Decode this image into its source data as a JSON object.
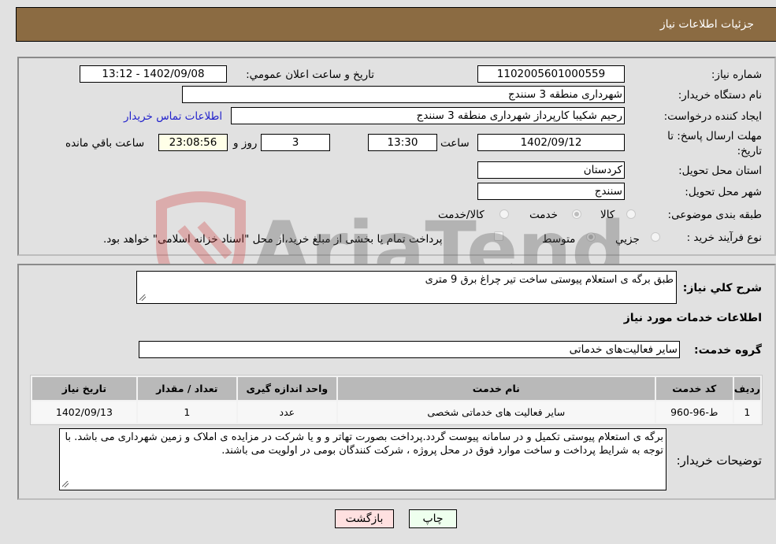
{
  "header": {
    "title": "جزئيات اطلاعات نياز"
  },
  "form": {
    "need_number": {
      "label": "شماره نياز:",
      "value": "1102005601000559"
    },
    "announce_datetime": {
      "label": "تاريخ و ساعت اعلان عمومي:",
      "value": "1402/09/08 - 13:12"
    },
    "buyer_org": {
      "label": "نام دستگاه خريدار:",
      "value": "شهرداری منطقه 3 سنندج"
    },
    "requester": {
      "label": "ايجاد کننده درخواست:",
      "value": "رحيم شکيبا کارپرداز شهرداری منطقه 3 سنندج"
    },
    "buyer_contact_link": "اطلاعات تماس خريدار",
    "deadline": {
      "label_line1": "مهلت ارسال پاسخ: تا",
      "label_line2": "تاريخ:",
      "date": "1402/09/12",
      "time_label": "ساعت",
      "time": "13:30",
      "days": "3",
      "days_label": "روز و",
      "remaining": "23:08:56",
      "remaining_label": "ساعت باقي مانده"
    },
    "province": {
      "label": "استان محل تحويل:",
      "value": "کردستان"
    },
    "city": {
      "label": "شهر محل تحويل:",
      "value": "سنندج"
    },
    "category": {
      "label": "طبقه بندی موضوعی:",
      "options": [
        "کالا",
        "خدمت",
        "کالا/خدمت"
      ],
      "selected": "خدمت"
    },
    "purchase_type": {
      "label": "نوع فرآيند خريد :",
      "options": [
        "جزيي",
        "متوسط"
      ],
      "selected": "متوسط",
      "treasury_note": "پرداخت تمام يا بخشی از مبلغ خريد،از محل \"اسناد خزانه اسلامی\" خواهد بود."
    }
  },
  "description": {
    "label": "شرح کلي نياز:",
    "value": "طبق برگه ی استعلام پيوستی ساخت تير چراغ برق 9 متری"
  },
  "services": {
    "section_title": "اطلاعات خدمات مورد نياز",
    "group_label": "گروه خدمت:",
    "group_value": "ساير فعاليت‌های خدماتی",
    "table": {
      "headers": [
        "رديف",
        "کد خدمت",
        "نام خدمت",
        "واحد اندازه گيری",
        "تعداد / مقدار",
        "تاريخ نياز"
      ],
      "rows": [
        [
          "1",
          "ط-96-960",
          "ساير فعاليت های خدماتی شخصی",
          "عدد",
          "1",
          "1402/09/13"
        ]
      ]
    }
  },
  "buyer_notes": {
    "label": "توضيحات خريدار:",
    "value": "برگه ی استعلام پيوستی تکميل و در سامانه پيوست گردد.پرداخت بصورت تهاتر و  و يا شرکت در مزايده ی املاک و زمين شهرداری می باشد. با توجه به شرايط پرداخت و ساخت موارد فوق در محل پروژه ، شرکت کنندگان بومی در اولويت می باشند."
  },
  "buttons": {
    "print": "چاپ",
    "back": "بازگشت"
  },
  "watermark": {
    "text": "AriaTender.neT"
  }
}
